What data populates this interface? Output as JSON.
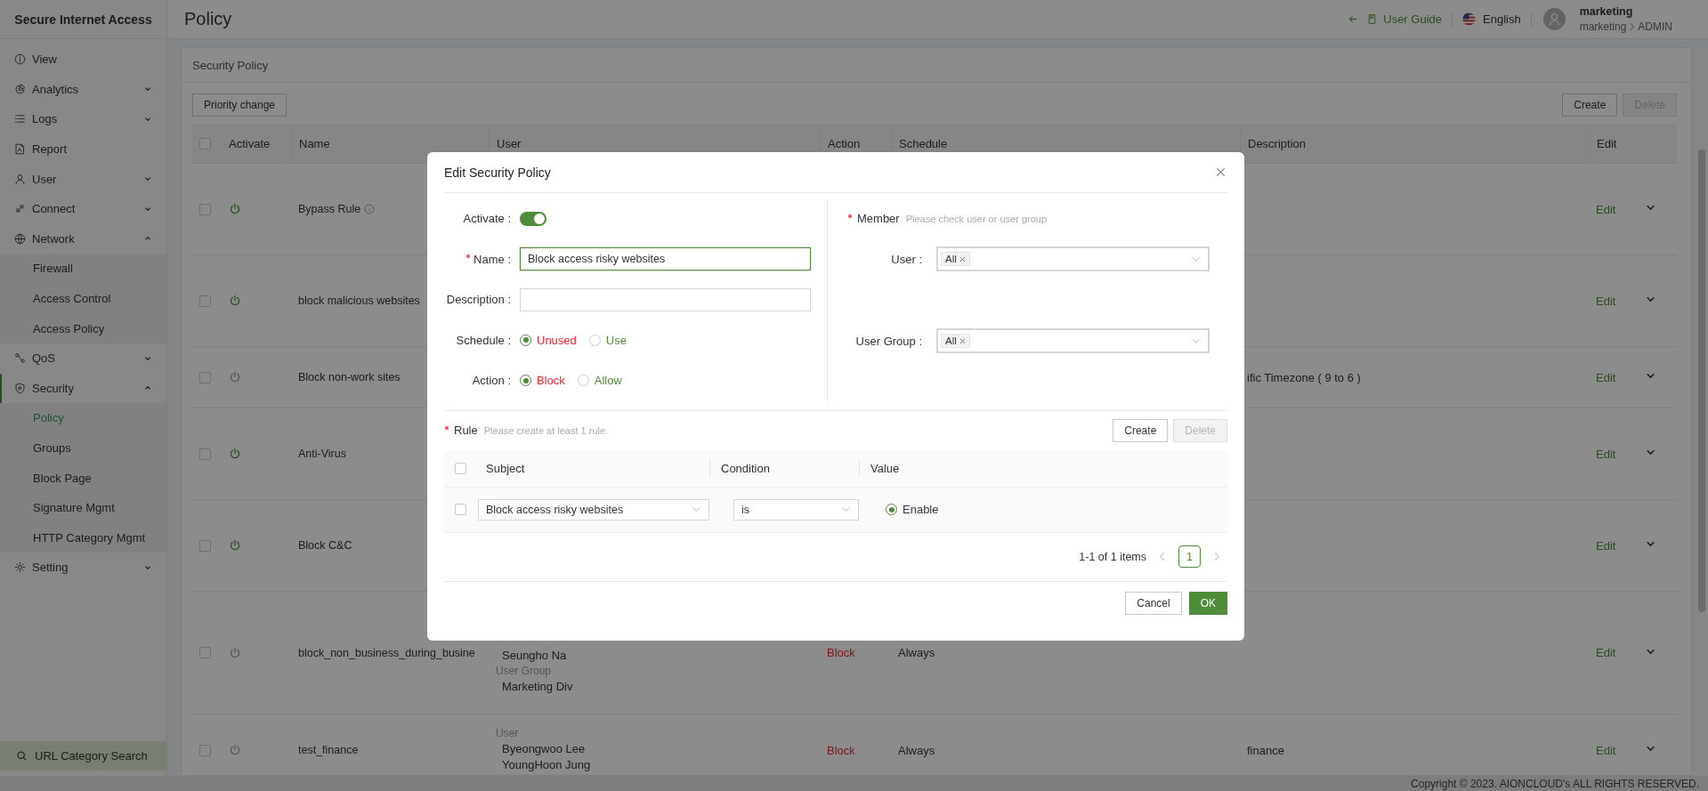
{
  "app": {
    "title": "Secure Internet Access"
  },
  "sidebar": {
    "items": [
      {
        "label": "View",
        "kind": "link",
        "selected": false
      },
      {
        "label": "Analytics",
        "kind": "group",
        "selected": false,
        "expanded": false
      },
      {
        "label": "Logs",
        "kind": "group",
        "selected": false,
        "expanded": false
      },
      {
        "label": "Report",
        "kind": "link",
        "selected": false
      },
      {
        "label": "User",
        "kind": "group",
        "selected": false,
        "expanded": false
      },
      {
        "label": "Connect",
        "kind": "group",
        "selected": false,
        "expanded": false
      },
      {
        "label": "Network",
        "kind": "group",
        "selected": false,
        "expanded": true,
        "children": [
          {
            "label": "Firewall",
            "selected": false
          },
          {
            "label": "Access Control",
            "selected": false
          },
          {
            "label": "Access Policy",
            "selected": false
          }
        ]
      },
      {
        "label": "QoS",
        "kind": "group",
        "selected": false,
        "expanded": false
      },
      {
        "label": "Security",
        "kind": "group",
        "selected": true,
        "expanded": true,
        "children": [
          {
            "label": "Policy",
            "selected": true
          },
          {
            "label": "Groups",
            "selected": false
          },
          {
            "label": "Block Page",
            "selected": false
          },
          {
            "label": "Signature Mgmt",
            "selected": false
          },
          {
            "label": "HTTP Category Mgmt",
            "selected": false
          }
        ]
      },
      {
        "label": "Setting",
        "kind": "group",
        "selected": false,
        "expanded": false
      }
    ],
    "search": "URL Category Search"
  },
  "header": {
    "title": "Policy",
    "user_guide": "User Guide",
    "language": "English",
    "user": {
      "name": "marketing",
      "org": "marketing",
      "role": "ADMIN"
    }
  },
  "panel": {
    "title": "Security Policy",
    "toolbar": {
      "left": [
        {
          "label": "Priority change",
          "disabled": false
        }
      ],
      "right": [
        {
          "label": "Create",
          "disabled": false
        },
        {
          "label": "Delete",
          "disabled": true
        }
      ]
    },
    "table": {
      "all_checked": false,
      "columns": [
        "Activate",
        "Name",
        "User",
        "Action",
        "Schedule",
        "Description",
        "Edit"
      ],
      "rows": [
        {
          "checked": false,
          "active": true,
          "name": "Bypass Rule",
          "info": true,
          "edit": "Edit",
          "expanded": false
        },
        {
          "checked": false,
          "active": true,
          "name": "block malicious websites",
          "info": false,
          "edit": "Edit",
          "expanded": false
        },
        {
          "checked": false,
          "active": false,
          "name": "Block non-work sites",
          "info": false,
          "description": "ific Timezone ( 9 to 6 )",
          "edit": "Edit",
          "expanded": false
        },
        {
          "checked": false,
          "active": true,
          "name": "Anti-Virus",
          "info": false,
          "edit": "Edit",
          "expanded": false
        },
        {
          "checked": false,
          "active": true,
          "name": "Block C&C",
          "info": false,
          "edit": "Edit",
          "expanded": false
        },
        {
          "checked": false,
          "active": false,
          "name": "block_non_business_during_busine",
          "info": false,
          "users": [
            {
              "kind": "name",
              "text": "Seungho Na"
            },
            {
              "kind": "heading",
              "text": "User Group"
            },
            {
              "kind": "name",
              "text": "Marketing Div"
            }
          ],
          "action": {
            "text": "Block",
            "kind": "block"
          },
          "schedule": "Always",
          "edit": "Edit",
          "expanded": false
        },
        {
          "checked": false,
          "active": false,
          "name": "test_finance",
          "info": false,
          "users": [
            {
              "kind": "heading",
              "text": "User"
            },
            {
              "kind": "name",
              "text": "Byeongwoo Lee"
            },
            {
              "kind": "name",
              "text": "YoungHoon Jung"
            }
          ],
          "action": {
            "text": "Block",
            "kind": "block"
          },
          "schedule": "Always",
          "description": "finance",
          "edit": "Edit",
          "expanded": false
        }
      ]
    }
  },
  "dialog": {
    "title": "Edit Security Policy",
    "activate": {
      "label": "Activate :",
      "on": true
    },
    "name": {
      "label": "Name :",
      "required": true,
      "value": "Block access risky websites"
    },
    "description": {
      "label": "Description :"
    },
    "schedule": {
      "label": "Schedule :",
      "options": [
        {
          "label": "Unused",
          "selected": true,
          "kind": "negative"
        },
        {
          "label": "Use",
          "selected": false,
          "kind": "positive"
        }
      ]
    },
    "action": {
      "label": "Action :",
      "options": [
        {
          "label": "Block",
          "selected": true,
          "kind": "negative"
        },
        {
          "label": "Allow",
          "selected": false,
          "kind": "positive"
        }
      ]
    },
    "member": {
      "label": "Member",
      "required": true,
      "hint": "Please check user or user group",
      "fields": [
        {
          "label": "User :",
          "tags": [
            "All"
          ]
        },
        {
          "label": "User Group :",
          "tags": [
            "All"
          ]
        }
      ]
    },
    "rule": {
      "label": "Rule",
      "required": true,
      "hint": "Please create at least 1 rule.",
      "buttons": [
        {
          "label": "Create",
          "disabled": false
        },
        {
          "label": "Delete",
          "disabled": true
        }
      ],
      "all_checked": false,
      "columns": [
        "Subject",
        "Condition",
        "Value"
      ],
      "rows": [
        {
          "checked": false,
          "subject": "Block access risky websites",
          "condition": "is",
          "value": {
            "label": "Enable",
            "selected": true
          }
        }
      ],
      "pagination": {
        "summary": "1-1 of 1 items",
        "pages": [
          {
            "label": "1",
            "selected": true
          }
        ]
      }
    },
    "footer": [
      {
        "label": "Cancel",
        "kind": "default"
      },
      {
        "label": "OK",
        "kind": "primary"
      }
    ]
  },
  "footer": {
    "copyright": "Copyright © 2023. AIONCLOUD's ALL RIGHTS RESERVED."
  }
}
